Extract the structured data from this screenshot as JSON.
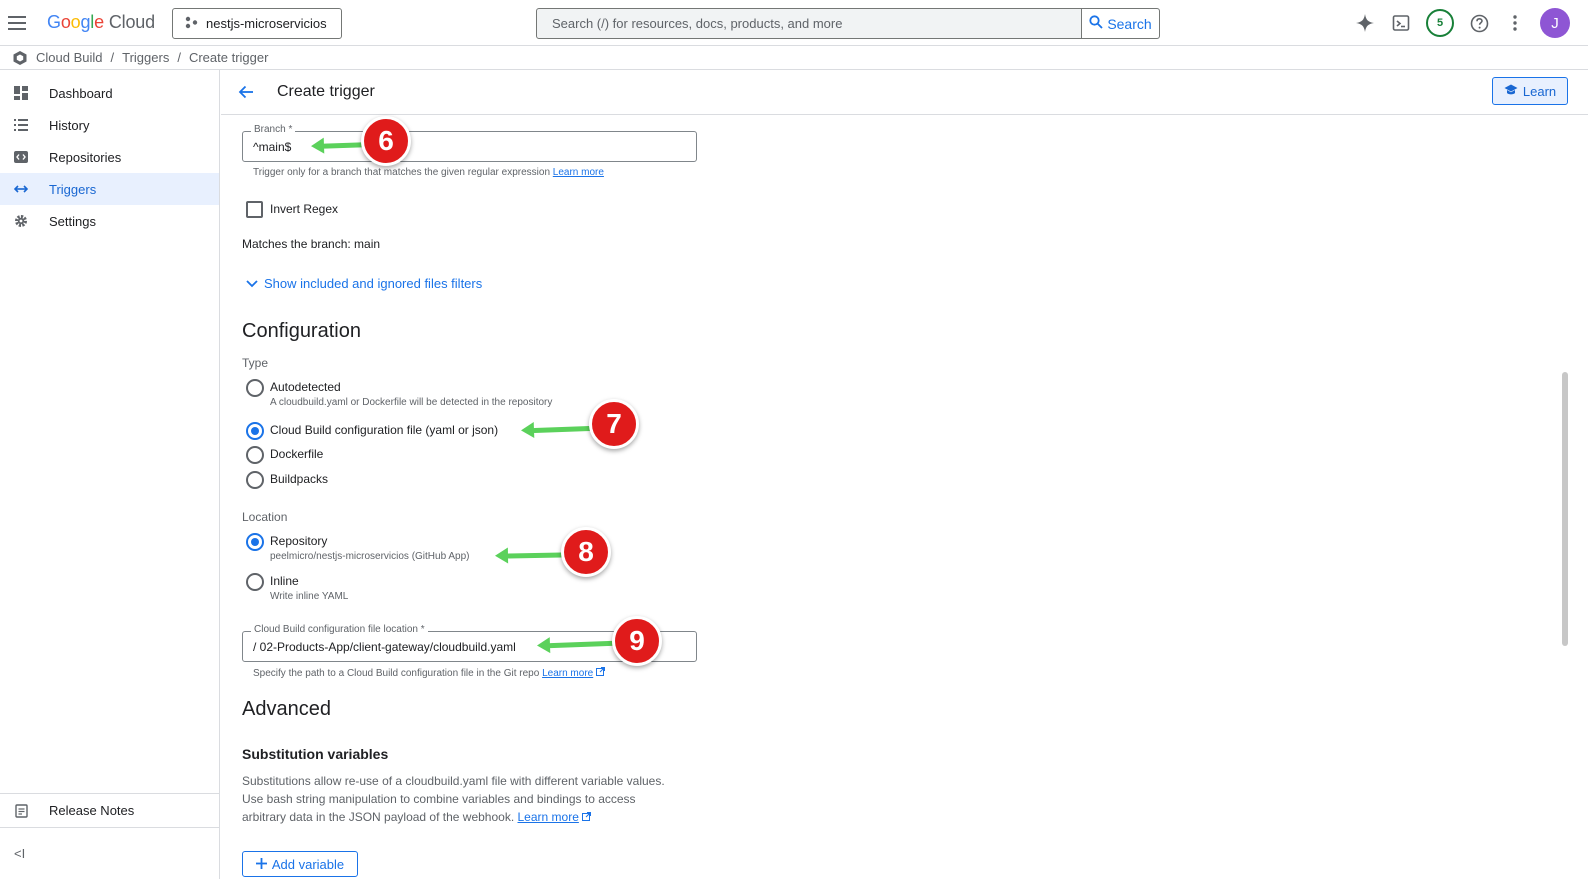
{
  "topbar": {
    "logo_g": "G",
    "logo_o1": "o",
    "logo_o2": "o",
    "logo_g2": "g",
    "logo_l": "l",
    "logo_e": "e",
    "logo_cloud": "Cloud",
    "project": "nestjs-microservicios",
    "search_placeholder": "Search (/) for resources, docs, products, and more",
    "search_button": "Search",
    "notifications_count": "5",
    "avatar_initial": "J"
  },
  "breadcrumb": {
    "items": [
      "Cloud Build",
      "Triggers",
      "Create trigger"
    ],
    "separator": "/"
  },
  "sidebar": {
    "items": [
      {
        "label": "Dashboard",
        "icon": "dashboard-icon"
      },
      {
        "label": "History",
        "icon": "list-icon"
      },
      {
        "label": "Repositories",
        "icon": "repository-icon"
      },
      {
        "label": "Triggers",
        "icon": "trigger-arrows-icon",
        "active": true
      },
      {
        "label": "Settings",
        "icon": "gear-icon"
      }
    ],
    "release_notes": "Release Notes",
    "collapse": "<I"
  },
  "header": {
    "title": "Create trigger",
    "learn": "Learn"
  },
  "form": {
    "branch_label": "Branch *",
    "branch_value": "^main$",
    "branch_hint": "Trigger only for a branch that matches the given regular expression",
    "learn_more": "Learn more",
    "invert_regex": "Invert Regex",
    "matches": "Matches the branch: main",
    "show_filters": "Show included and ignored files filters",
    "configuration": "Configuration",
    "type_label": "Type",
    "types": [
      {
        "label": "Autodetected",
        "sub": "A cloudbuild.yaml or Dockerfile will be detected in the repository",
        "checked": false
      },
      {
        "label": "Cloud Build configuration file (yaml or json)",
        "sub": "",
        "checked": true
      },
      {
        "label": "Dockerfile",
        "sub": "",
        "checked": false
      },
      {
        "label": "Buildpacks",
        "sub": "",
        "checked": false
      }
    ],
    "location_label": "Location",
    "locations": [
      {
        "label": "Repository",
        "sub": "peelmicro/nestjs-microservicios (GitHub App)",
        "checked": true
      },
      {
        "label": "Inline",
        "sub": "Write inline YAML",
        "checked": false
      }
    ],
    "config_location_label": "Cloud Build configuration file location *",
    "config_location_value": "/ 02-Products-App/client-gateway/cloudbuild.yaml",
    "config_location_hint": "Specify the path to a Cloud Build configuration file in the Git repo",
    "advanced": "Advanced",
    "substitution_title": "Substitution variables",
    "substitution_text_1": "Substitutions allow re-use of a cloudbuild.yaml file with different variable values.",
    "substitution_text_2": "Use bash string manipulation to combine variables and bindings to access",
    "substitution_text_3": "arbitrary data in the JSON payload of the webhook.",
    "add_variable": "Add variable"
  },
  "annotations": {
    "step6": "6",
    "step7": "7",
    "step8": "8",
    "step9": "9"
  },
  "colors": {
    "accent": "#1a73e8",
    "active_bg": "#e8f0fe",
    "marker": "#e01b1b",
    "arrow": "#5bd15b"
  }
}
